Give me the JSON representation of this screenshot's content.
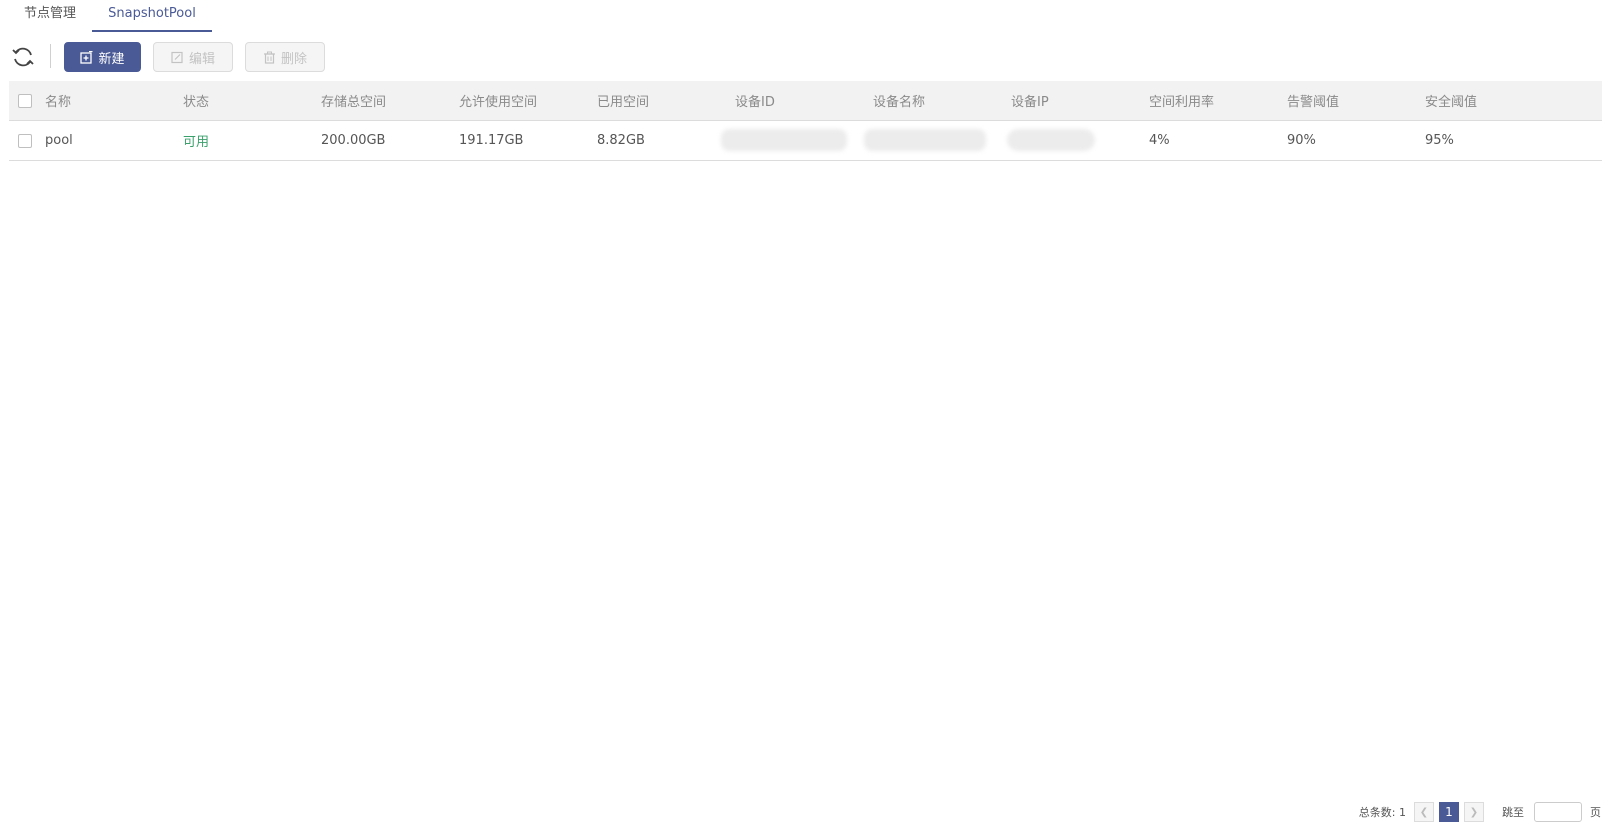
{
  "tabs": [
    {
      "label": "节点管理",
      "active": false
    },
    {
      "label": "SnapshotPool",
      "active": true
    }
  ],
  "toolbar": {
    "refresh_icon": "refresh-icon",
    "new_label": "新建",
    "edit_label": "编辑",
    "delete_label": "删除"
  },
  "table": {
    "headers": [
      "名称",
      "状态",
      "存储总空间",
      "允许使用空间",
      "已用空间",
      "设备ID",
      "设备名称",
      "设备IP",
      "空间利用率",
      "告警阈值",
      "安全阈值"
    ],
    "rows": [
      {
        "name": "pool",
        "status": "可用",
        "total": "200.00GB",
        "allowed": "191.17GB",
        "used": "8.82GB",
        "usage": "4%",
        "alarm": "90%",
        "safe": "95%"
      }
    ]
  },
  "pagination": {
    "total_label": "总条数: 1",
    "current_page": "1",
    "jump_label": "跳至",
    "page_unit": "页",
    "jump_value": ""
  },
  "colors": {
    "primary": "#4a5a96",
    "status_ok": "#3aa06b"
  }
}
